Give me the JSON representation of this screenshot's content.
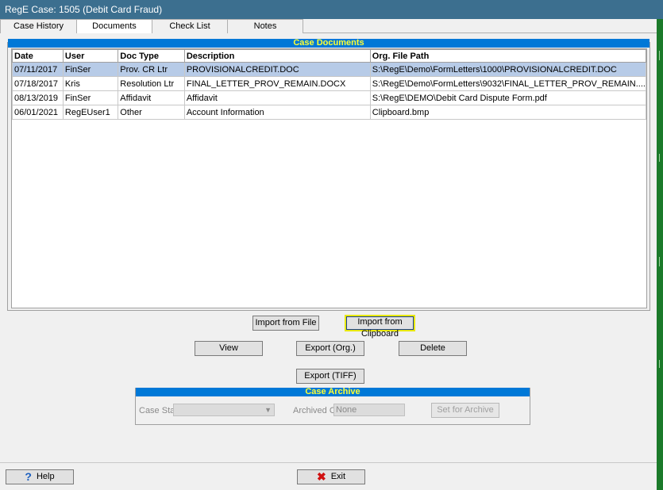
{
  "window": {
    "title": "RegE Case: 1505 (Debit Card Fraud)"
  },
  "tabs": [
    {
      "label": "Case History"
    },
    {
      "label": "Documents",
      "active": true
    },
    {
      "label": "Check List"
    },
    {
      "label": "Notes"
    }
  ],
  "documents": {
    "header": "Case Documents",
    "columns": [
      "Date",
      "User",
      "Doc Type",
      "Description",
      "Org. File Path"
    ],
    "rows": [
      {
        "date": "07/11/2017",
        "user": "FinSer",
        "doc_type": "Prov. CR Ltr",
        "description": "PROVISIONALCREDIT.DOC",
        "path": "S:\\RegE\\Demo\\FormLetters\\1000\\PROVISIONALCREDIT.DOC",
        "selected": true
      },
      {
        "date": "07/18/2017",
        "user": "Kris",
        "doc_type": "Resolution Ltr",
        "description": "FINAL_LETTER_PROV_REMAIN.DOCX",
        "path": "S:\\RegE\\Demo\\FormLetters\\9032\\FINAL_LETTER_PROV_REMAIN...."
      },
      {
        "date": "08/13/2019",
        "user": "FinSer",
        "doc_type": "Affidavit",
        "description": "Affidavit",
        "path": "S:\\RegE\\DEMO\\Debit Card Dispute Form.pdf"
      },
      {
        "date": "06/01/2021",
        "user": "RegEUser1",
        "doc_type": "Other",
        "description": "Account Information",
        "path": "Clipboard.bmp"
      }
    ]
  },
  "buttons": {
    "import_file": "Import from File",
    "import_clipboard": "Import from Clipboard",
    "view": "View",
    "export_org": "Export (Org.)",
    "delete": "Delete",
    "export_tiff": "Export (TIFF)"
  },
  "archive": {
    "header": "Case Archive",
    "case_state_label": "Case State",
    "case_state_value": "",
    "archived_on_label": "Archived On:",
    "archived_on_value": "None",
    "set_archive": "Set for Archive"
  },
  "footer": {
    "help": "Help",
    "exit": "Exit"
  },
  "colors": {
    "title_bar": "#3c6f8f",
    "section_header_bg": "#0078d7",
    "section_header_text": "#ffff33",
    "selected_row": "#b7cbe7"
  },
  "icons": {
    "help": "question-icon",
    "exit": "red-x-icon"
  }
}
